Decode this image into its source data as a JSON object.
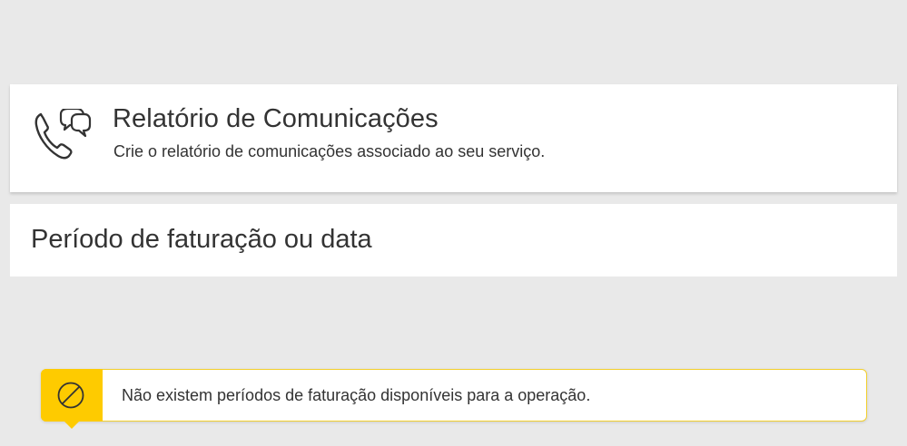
{
  "header": {
    "title": "Relatório de Comunicações",
    "subtitle": "Crie o relatório de comunicações associado ao seu serviço.",
    "icon": "phone-chat-icon"
  },
  "period": {
    "title": "Período de faturação ou data"
  },
  "alert": {
    "icon": "no-entry-icon",
    "message": "Não existem períodos de faturação disponíveis para a operação.",
    "accent_color": "#fecb00"
  }
}
